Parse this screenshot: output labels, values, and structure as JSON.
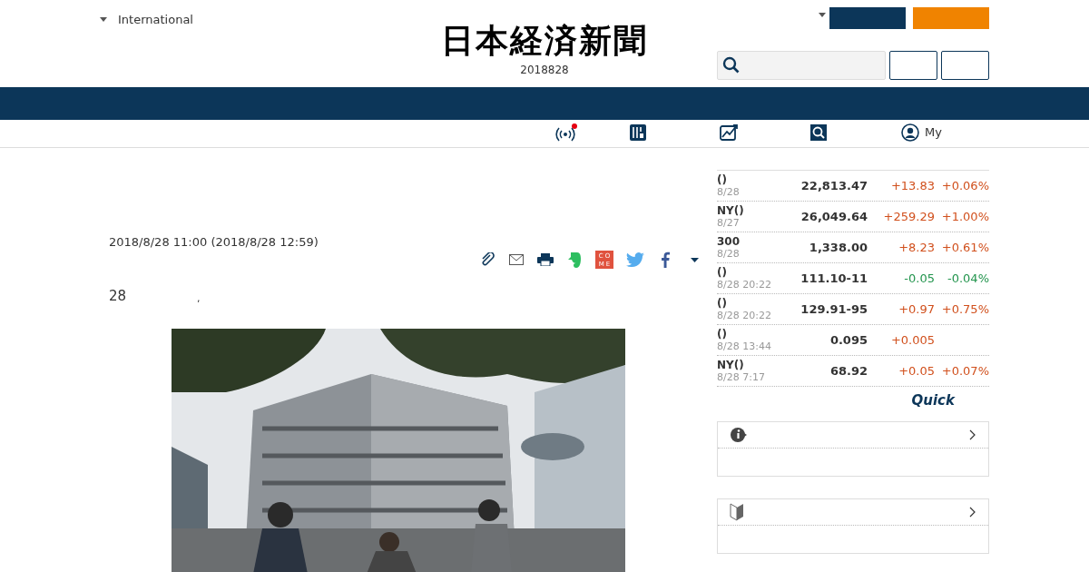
{
  "header": {
    "edition": "International",
    "logo": "日本経済新聞",
    "date": "2018828"
  },
  "nav": [
    {
      "kind": "live",
      "alert": true
    },
    {
      "kind": "paper"
    },
    {
      "kind": "chart"
    },
    {
      "kind": "search"
    },
    {
      "kind": "user",
      "label": "My"
    }
  ],
  "article": {
    "timestamp": "2018/8/28 11:00 (2018/8/28 12:59)",
    "share": [
      {
        "kind": "clip"
      },
      {
        "kind": "mail"
      },
      {
        "kind": "print"
      },
      {
        "kind": "evernote"
      },
      {
        "kind": "come",
        "label": "COME"
      },
      {
        "kind": "twitter"
      },
      {
        "kind": "facebook"
      },
      {
        "kind": "more"
      }
    ],
    "body": [
      {
        "text": "28"
      },
      {
        "text": ","
      }
    ]
  },
  "markets": {
    "rows": [
      {
        "name": "()",
        "date": "8/28",
        "value": "22,813.47",
        "change": "+13.83",
        "percent": "+0.06%",
        "color": "#d1501d"
      },
      {
        "name": "NY()",
        "date": "8/27",
        "value": "26,049.64",
        "change": "+259.29",
        "percent": "+1.00%",
        "color": "#d1501d"
      },
      {
        "name": "300",
        "date": "8/28",
        "value": "1,338.00",
        "change": "+8.23",
        "percent": "+0.61%",
        "color": "#d1501d"
      },
      {
        "name": "()",
        "date": "8/28 20:22",
        "value": "111.10-11",
        "change": "-0.05",
        "percent": "-0.04%",
        "color": "#22944d"
      },
      {
        "name": "()",
        "date": "8/28 20:22",
        "value": "129.91-95",
        "change": "+0.97",
        "percent": "+0.75%",
        "color": "#d1501d"
      },
      {
        "name": "()",
        "date": "8/28 13:44",
        "value": "0.095",
        "change": "+0.005",
        "color": "#d1501d"
      },
      {
        "name": "NY()",
        "date": "8/28 7:17",
        "value": "68.92",
        "change": "+0.05",
        "percent": "+0.07%",
        "color": "#d1501d"
      }
    ],
    "provider": "Quick"
  },
  "panels": [
    {
      "kind": "info"
    },
    {
      "kind": "beginner"
    }
  ]
}
